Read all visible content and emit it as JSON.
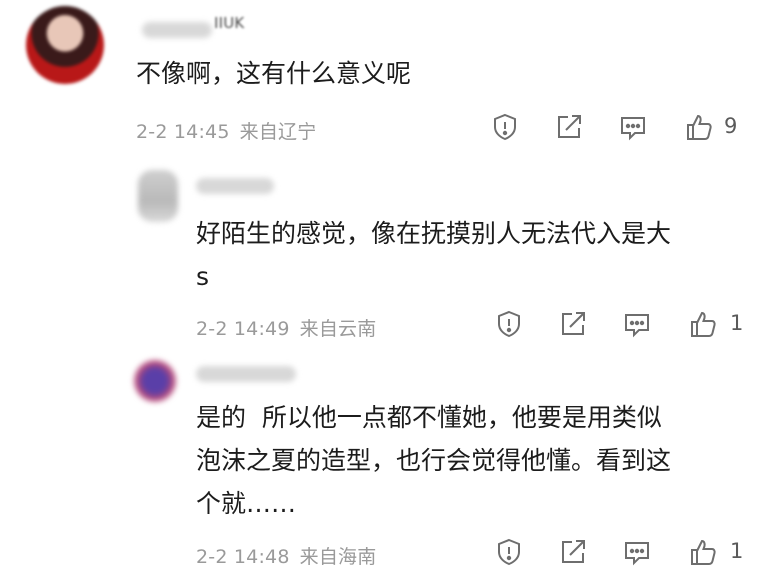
{
  "comments": [
    {
      "text": "不像啊，这有什么意义呢",
      "date": "2-2 14:45",
      "source": "来自辽宁",
      "likes": "9",
      "username_suffix": "IIUK"
    },
    {
      "text": "好陌生的感觉，像在抚摸别人无法代入是大\ns",
      "date": "2-2 14:49",
      "source": "来自云南",
      "likes": "1"
    },
    {
      "text": "是的  所以他一点都不懂她，他要是用类似\n泡沫之夏的造型，也行会觉得他懂。看到这\n个就……",
      "date": "2-2 14:48",
      "source": "来自海南",
      "likes": "1"
    }
  ],
  "icons": {
    "report": "report-icon",
    "share": "share-icon",
    "reply": "reply-icon",
    "like": "thumbs-up-icon"
  },
  "colors": {
    "text": "#1c1c1c",
    "meta": "#9a9a9a",
    "icon": "#7a7a7a"
  }
}
